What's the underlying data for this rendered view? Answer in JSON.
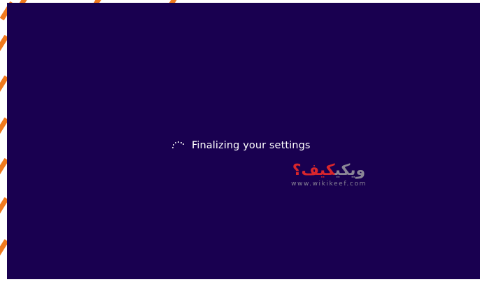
{
  "screen": {
    "background": "#190050",
    "status_text": "Finalizing your settings",
    "spinner_icon": "loading-spinner-icon"
  },
  "watermark": {
    "arabic_part_1": "ویکی",
    "arabic_part_2": "کیف؟",
    "url": "www.wikikeef.com",
    "color_gray": "#8a8596",
    "color_red": "#d8262c"
  },
  "frame": {
    "accent": "#f07a1e"
  }
}
